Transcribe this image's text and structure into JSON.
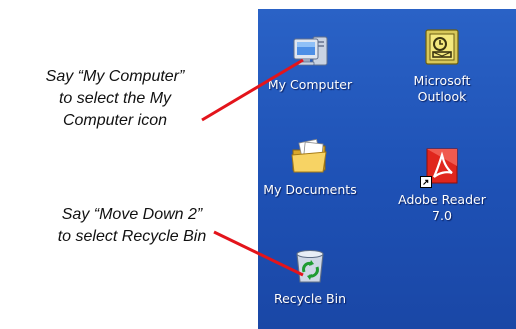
{
  "instructions": [
    {
      "line1": "Say “My Computer”",
      "line2": "to select the My",
      "line3": "Computer icon"
    },
    {
      "line1": "Say “Move Down 2”",
      "line2": "to select Recycle Bin"
    }
  ],
  "pointer_color": "#e3141b",
  "desktop": {
    "background": "#1f53b7",
    "icons": [
      {
        "label": "My Computer",
        "icon": "my-computer-icon"
      },
      {
        "label": "Microsoft Outlook",
        "icon": "outlook-icon"
      },
      {
        "label": "My Documents",
        "icon": "my-documents-icon"
      },
      {
        "label": "Adobe Reader 7.0",
        "icon": "adobe-reader-icon"
      },
      {
        "label": "Recycle Bin",
        "icon": "recycle-bin-icon"
      }
    ]
  }
}
